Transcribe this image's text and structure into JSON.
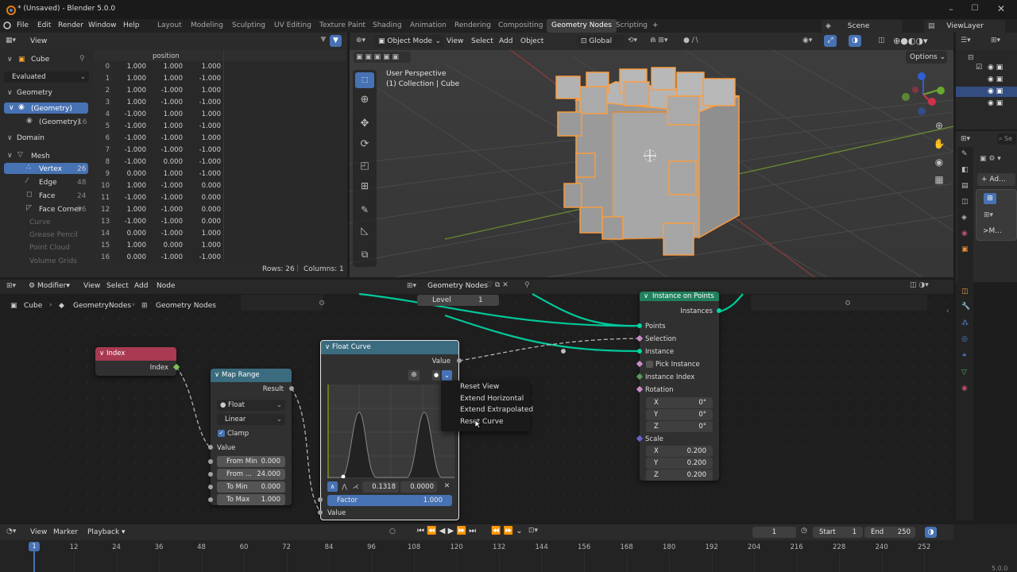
{
  "window": {
    "title": "* (Unsaved) - Blender 5.0.0",
    "icons": [
      "minimize-icon",
      "maximize-icon",
      "close-icon"
    ]
  },
  "menu": {
    "file": "File",
    "edit": "Edit",
    "render": "Render",
    "window": "Window",
    "help": "Help"
  },
  "workspaces": [
    "Layout",
    "Modeling",
    "Sculpting",
    "UV Editing",
    "Texture Paint",
    "Shading",
    "Animation",
    "Rendering",
    "Compositing",
    "Geometry Nodes",
    "Scripting"
  ],
  "active_workspace": "Geometry Nodes",
  "scene": "Scene",
  "view_layer": "ViewLayer",
  "spreadsheet": {
    "view_label": "View",
    "object": "Cube",
    "evaluated": "Evaluated",
    "geometry_label": "Geometry",
    "geometry_item": "(Geometry)",
    "geometry_sub": "(Geometry)",
    "geometry_sub_count": "16",
    "domain_label": "Domain",
    "mesh_label": "Mesh",
    "domains": [
      {
        "name": "Vertex",
        "count": "26"
      },
      {
        "name": "Edge",
        "count": "48"
      },
      {
        "name": "Face",
        "count": "24"
      },
      {
        "name": "Face Corner",
        "count": "96"
      }
    ],
    "disabled": [
      "Curve",
      "Grease Pencil",
      "Point Cloud",
      "Volume Grids"
    ],
    "column_header": "position",
    "rows": [
      [
        "0",
        "1.000",
        "1.000",
        "1.000"
      ],
      [
        "1",
        "1.000",
        "1.000",
        "-1.000"
      ],
      [
        "2",
        "1.000",
        "-1.000",
        "1.000"
      ],
      [
        "3",
        "1.000",
        "-1.000",
        "-1.000"
      ],
      [
        "4",
        "-1.000",
        "1.000",
        "1.000"
      ],
      [
        "5",
        "-1.000",
        "1.000",
        "-1.000"
      ],
      [
        "6",
        "-1.000",
        "-1.000",
        "1.000"
      ],
      [
        "7",
        "-1.000",
        "-1.000",
        "-1.000"
      ],
      [
        "8",
        "-1.000",
        "0.000",
        "-1.000"
      ],
      [
        "9",
        "0.000",
        "1.000",
        "-1.000"
      ],
      [
        "10",
        "1.000",
        "-1.000",
        "0.000"
      ],
      [
        "11",
        "-1.000",
        "-1.000",
        "0.000"
      ],
      [
        "12",
        "1.000",
        "-1.000",
        "0.000"
      ],
      [
        "13",
        "-1.000",
        "-1.000",
        "0.000"
      ],
      [
        "14",
        "0.000",
        "-1.000",
        "1.000"
      ],
      [
        "15",
        "1.000",
        "0.000",
        "1.000"
      ],
      [
        "16",
        "0.000",
        "-1.000",
        "-1.000"
      ]
    ],
    "rows_info": "Rows: 26",
    "columns_info": "Columns: 1"
  },
  "viewport": {
    "mode": "Object Mode",
    "menus": [
      "View",
      "Select",
      "Add",
      "Object"
    ],
    "transform": "Global",
    "options": "Options",
    "perspective": "User Perspective",
    "collection": "(1) Collection | Cube"
  },
  "node_editor": {
    "editor_label": "Modifier",
    "menus": [
      "View",
      "Select",
      "Add",
      "Node"
    ],
    "tree_name": "Geometry Nodes",
    "breadcrumbs": [
      "Cube",
      "GeometryNodes",
      "Geometry Nodes"
    ],
    "level_label": "Level",
    "level_value": "1",
    "index_node": {
      "title": "Index",
      "output": "Index"
    },
    "map_range": {
      "title": "Map Range",
      "output": "Result",
      "data_type": "Float",
      "interp": "Linear",
      "clamp": "Clamp",
      "value": "Value",
      "fields": [
        {
          "label": "From Min",
          "value": "0.000"
        },
        {
          "label": "From ...",
          "value": "24.000"
        },
        {
          "label": "To Min",
          "value": "0.000"
        },
        {
          "label": "To Max",
          "value": "1.000"
        }
      ]
    },
    "float_curve": {
      "title": "Float Curve",
      "output": "Value",
      "point_x": "0.1318",
      "point_y": "0.0000",
      "factor_label": "Factor",
      "factor_value": "1.000",
      "input": "Value"
    },
    "context_menu": [
      "Reset View",
      "Extend Horizontal",
      "Extend Extrapolated",
      "Reset Curve"
    ],
    "instance_on_points": {
      "title": "Instance on Points",
      "output": "Instances",
      "inputs": [
        "Points",
        "Selection",
        "Instance",
        "Pick Instance",
        "Instance Index",
        "Rotation"
      ],
      "rotation": [
        {
          "axis": "X",
          "value": "0°"
        },
        {
          "axis": "Y",
          "value": "0°"
        },
        {
          "axis": "Z",
          "value": "0°"
        }
      ],
      "scale_label": "Scale",
      "scale": [
        {
          "axis": "X",
          "value": "0.200"
        },
        {
          "axis": "Y",
          "value": "0.200"
        },
        {
          "axis": "Z",
          "value": "0.200"
        }
      ]
    }
  },
  "timeline": {
    "menus": [
      "View",
      "Marker",
      "Playback"
    ],
    "current_frame": "1",
    "start_label": "Start",
    "start": "1",
    "end_label": "End",
    "end": "250",
    "ruler": [
      "12",
      "24",
      "36",
      "48",
      "60",
      "72",
      "84",
      "96",
      "108",
      "120",
      "132",
      "144",
      "156",
      "168",
      "180",
      "192",
      "204",
      "216",
      "228",
      "240",
      "252"
    ],
    "cursor": "1"
  },
  "properties": {
    "add_modifier": "+ Ad...",
    "modifier_short": ">M..."
  },
  "version": "5.0.0",
  "colors": {
    "accent": "#4772b3",
    "geometry_socket": "#00d6a3",
    "orange_select": "#ff9d3b",
    "index_header": "#a83a52",
    "map_range_header": "#3a6b7e",
    "float_curve_header": "#3a6b7e",
    "instance_header": "#22805d"
  }
}
